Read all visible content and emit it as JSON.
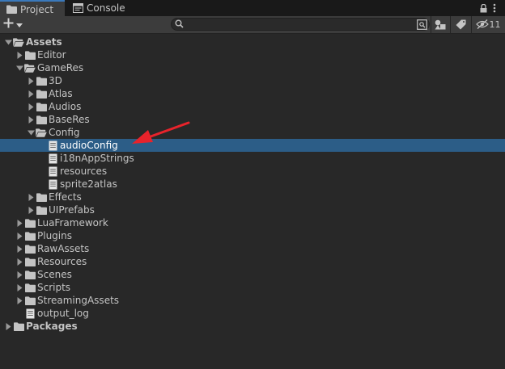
{
  "tabs": [
    {
      "label": "Project",
      "icon": "folder-icon",
      "active": true
    },
    {
      "label": "Console",
      "icon": "console-icon",
      "active": false
    }
  ],
  "toolbar": {
    "create_icon": "plus-icon",
    "search_placeholder": "",
    "hidden_count": "11"
  },
  "tree": [
    {
      "label": "Assets",
      "depth": 0,
      "type": "folder",
      "expanded": true,
      "bold": true,
      "selected": false
    },
    {
      "label": "Editor",
      "depth": 1,
      "type": "folder",
      "expanded": false,
      "bold": false,
      "selected": false
    },
    {
      "label": "GameRes",
      "depth": 1,
      "type": "folder",
      "expanded": true,
      "bold": false,
      "selected": false
    },
    {
      "label": "3D",
      "depth": 2,
      "type": "folder",
      "expanded": false,
      "bold": false,
      "selected": false
    },
    {
      "label": "Atlas",
      "depth": 2,
      "type": "folder",
      "expanded": false,
      "bold": false,
      "selected": false
    },
    {
      "label": "Audios",
      "depth": 2,
      "type": "folder",
      "expanded": false,
      "bold": false,
      "selected": false
    },
    {
      "label": "BaseRes",
      "depth": 2,
      "type": "folder",
      "expanded": false,
      "bold": false,
      "selected": false
    },
    {
      "label": "Config",
      "depth": 2,
      "type": "folder",
      "expanded": true,
      "bold": false,
      "selected": false
    },
    {
      "label": "audioConfig",
      "depth": 3,
      "type": "file",
      "expanded": false,
      "bold": false,
      "selected": true
    },
    {
      "label": "i18nAppStrings",
      "depth": 3,
      "type": "file",
      "expanded": false,
      "bold": false,
      "selected": false
    },
    {
      "label": "resources",
      "depth": 3,
      "type": "file",
      "expanded": false,
      "bold": false,
      "selected": false
    },
    {
      "label": "sprite2atlas",
      "depth": 3,
      "type": "file",
      "expanded": false,
      "bold": false,
      "selected": false
    },
    {
      "label": "Effects",
      "depth": 2,
      "type": "folder",
      "expanded": false,
      "bold": false,
      "selected": false
    },
    {
      "label": "UIPrefabs",
      "depth": 2,
      "type": "folder",
      "expanded": false,
      "bold": false,
      "selected": false
    },
    {
      "label": "LuaFramework",
      "depth": 1,
      "type": "folder",
      "expanded": false,
      "bold": false,
      "selected": false
    },
    {
      "label": "Plugins",
      "depth": 1,
      "type": "folder",
      "expanded": false,
      "bold": false,
      "selected": false
    },
    {
      "label": "RawAssets",
      "depth": 1,
      "type": "folder",
      "expanded": false,
      "bold": false,
      "selected": false
    },
    {
      "label": "Resources",
      "depth": 1,
      "type": "folder",
      "expanded": false,
      "bold": false,
      "selected": false
    },
    {
      "label": "Scenes",
      "depth": 1,
      "type": "folder",
      "expanded": false,
      "bold": false,
      "selected": false
    },
    {
      "label": "Scripts",
      "depth": 1,
      "type": "folder",
      "expanded": false,
      "bold": false,
      "selected": false
    },
    {
      "label": "StreamingAssets",
      "depth": 1,
      "type": "folder",
      "expanded": false,
      "bold": false,
      "selected": false
    },
    {
      "label": "output_log",
      "depth": 1,
      "type": "file",
      "expanded": false,
      "bold": false,
      "selected": false
    },
    {
      "label": "Packages",
      "depth": 0,
      "type": "folder",
      "expanded": false,
      "bold": true,
      "selected": false
    }
  ],
  "colors": {
    "selection": "#2c5d87",
    "annotation_arrow": "#e8232b",
    "panel_bg": "#282828"
  }
}
